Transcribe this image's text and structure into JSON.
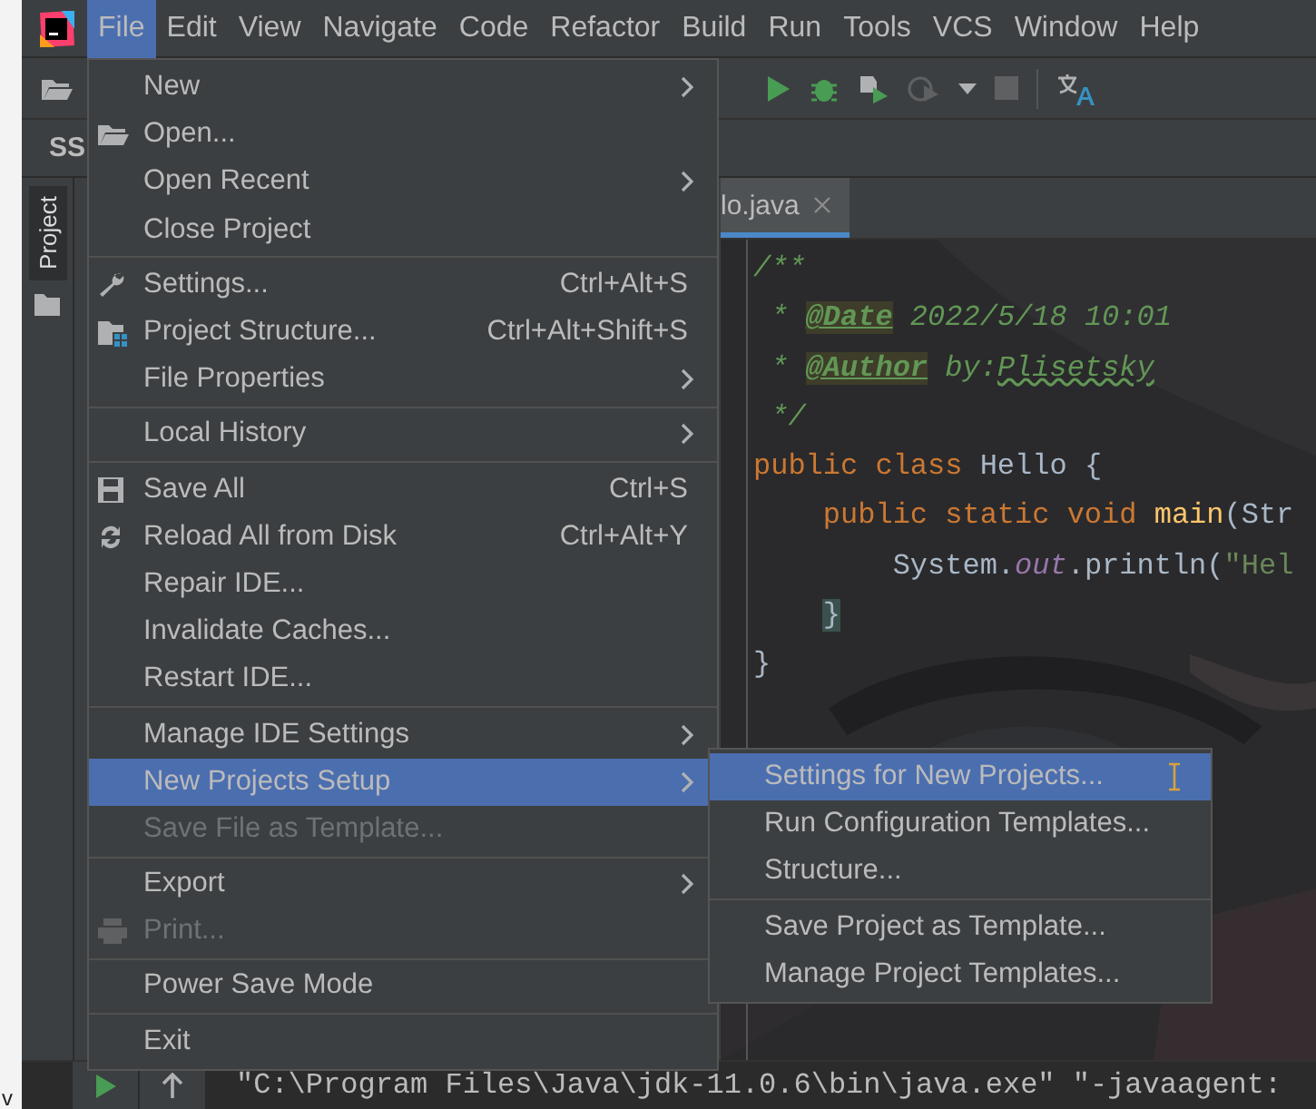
{
  "desktop": {
    "fragment": "v"
  },
  "menubar": [
    {
      "label": "File",
      "selected": true
    },
    {
      "label": "Edit",
      "selected": false
    },
    {
      "label": "View",
      "selected": false
    },
    {
      "label": "Navigate",
      "selected": false
    },
    {
      "label": "Code",
      "selected": false
    },
    {
      "label": "Refactor",
      "selected": false
    },
    {
      "label": "Build",
      "selected": false
    },
    {
      "label": "Run",
      "selected": false
    },
    {
      "label": "Tools",
      "selected": false
    },
    {
      "label": "VCS",
      "selected": false
    },
    {
      "label": "Window",
      "selected": false
    },
    {
      "label": "Help",
      "selected": false
    }
  ],
  "navbar": {
    "project": "SS"
  },
  "tool_window_stripe": {
    "label": "Project"
  },
  "editor": {
    "tab": {
      "label": "lo.java",
      "selected": true
    },
    "lines": [
      [
        {
          "text": "/**",
          "kind": "comment"
        }
      ],
      [
        {
          "text": " * ",
          "kind": "comment"
        },
        {
          "text": "@Date",
          "kind": "doctag"
        },
        {
          "text": " 2022/5/18 10:01",
          "kind": "comment"
        }
      ],
      [
        {
          "text": " * ",
          "kind": "comment"
        },
        {
          "text": "@Author",
          "kind": "doctag"
        },
        {
          "text": " by:",
          "kind": "comment"
        },
        {
          "text": "Plisetsky",
          "kind": "typo"
        }
      ],
      [
        {
          "text": " */",
          "kind": "comment"
        }
      ],
      [
        {
          "text": "public class ",
          "kind": "keyword"
        },
        {
          "text": "Hello {",
          "kind": "plain"
        }
      ],
      [
        {
          "text": "    public static void ",
          "kind": "keyword"
        },
        {
          "text": "main",
          "kind": "method"
        },
        {
          "text": "(Str",
          "kind": "plain"
        }
      ],
      [
        {
          "text": "        System.",
          "kind": "plain"
        },
        {
          "text": "out",
          "kind": "field"
        },
        {
          "text": ".println(",
          "kind": "plain"
        },
        {
          "text": "\"Hel",
          "kind": "string"
        }
      ],
      [
        {
          "text": "}",
          "kind": "indented_brace"
        }
      ],
      [
        {
          "text": "}",
          "kind": "plain"
        }
      ]
    ]
  },
  "file_menu": [
    {
      "kind": "item",
      "label": "New",
      "submenu": true,
      "disabled": false,
      "selected": false
    },
    {
      "kind": "item",
      "label": "Open...",
      "submenu": false,
      "disabled": false,
      "selected": false
    },
    {
      "kind": "item",
      "label": "Open Recent",
      "submenu": true,
      "disabled": false,
      "selected": false
    },
    {
      "kind": "item",
      "label": "Close Project",
      "submenu": false,
      "disabled": false,
      "selected": false
    },
    {
      "kind": "separator"
    },
    {
      "kind": "item",
      "label": "Settings...",
      "shortcut": "Ctrl+Alt+S",
      "submenu": false,
      "disabled": false,
      "selected": false
    },
    {
      "kind": "item",
      "label": "Project Structure...",
      "shortcut": "Ctrl+Alt+Shift+S",
      "submenu": false,
      "disabled": false,
      "selected": false
    },
    {
      "kind": "item",
      "label": "File Properties",
      "submenu": true,
      "disabled": false,
      "selected": false
    },
    {
      "kind": "separator"
    },
    {
      "kind": "item",
      "label": "Local History",
      "submenu": true,
      "disabled": false,
      "selected": false
    },
    {
      "kind": "separator"
    },
    {
      "kind": "item",
      "label": "Save All",
      "shortcut": "Ctrl+S",
      "submenu": false,
      "disabled": false,
      "selected": false
    },
    {
      "kind": "item",
      "label": "Reload All from Disk",
      "shortcut": "Ctrl+Alt+Y",
      "submenu": false,
      "disabled": false,
      "selected": false
    },
    {
      "kind": "item",
      "label": "Repair IDE...",
      "submenu": false,
      "disabled": false,
      "selected": false
    },
    {
      "kind": "item",
      "label": "Invalidate Caches...",
      "submenu": false,
      "disabled": false,
      "selected": false
    },
    {
      "kind": "item",
      "label": "Restart IDE...",
      "submenu": false,
      "disabled": false,
      "selected": false
    },
    {
      "kind": "separator"
    },
    {
      "kind": "item",
      "label": "Manage IDE Settings",
      "submenu": true,
      "disabled": false,
      "selected": false
    },
    {
      "kind": "item",
      "label": "New Projects Setup",
      "submenu": true,
      "disabled": false,
      "selected": true
    },
    {
      "kind": "item",
      "label": "Save File as Template...",
      "submenu": false,
      "disabled": true,
      "selected": false
    },
    {
      "kind": "separator"
    },
    {
      "kind": "item",
      "label": "Export",
      "submenu": true,
      "disabled": false,
      "selected": false
    },
    {
      "kind": "item",
      "label": "Print...",
      "submenu": false,
      "disabled": true,
      "selected": false
    },
    {
      "kind": "separator"
    },
    {
      "kind": "item",
      "label": "Power Save Mode",
      "submenu": false,
      "disabled": false,
      "selected": false
    },
    {
      "kind": "separator"
    },
    {
      "kind": "item",
      "label": "Exit",
      "submenu": false,
      "disabled": false,
      "selected": false
    }
  ],
  "submenu": [
    {
      "kind": "item",
      "label": "Settings for New Projects...",
      "selected": true
    },
    {
      "kind": "item",
      "label": "Run Configuration Templates...",
      "selected": false
    },
    {
      "kind": "item",
      "label": "Structure...",
      "selected": false
    },
    {
      "kind": "separator"
    },
    {
      "kind": "item",
      "label": "Save Project as Template...",
      "selected": false
    },
    {
      "kind": "item",
      "label": "Manage Project Templates...",
      "selected": false
    }
  ],
  "run_panel": {
    "console": "\"C:\\Program Files\\Java\\jdk-11.0.6\\bin\\java.exe\" \"-javaagent:"
  }
}
